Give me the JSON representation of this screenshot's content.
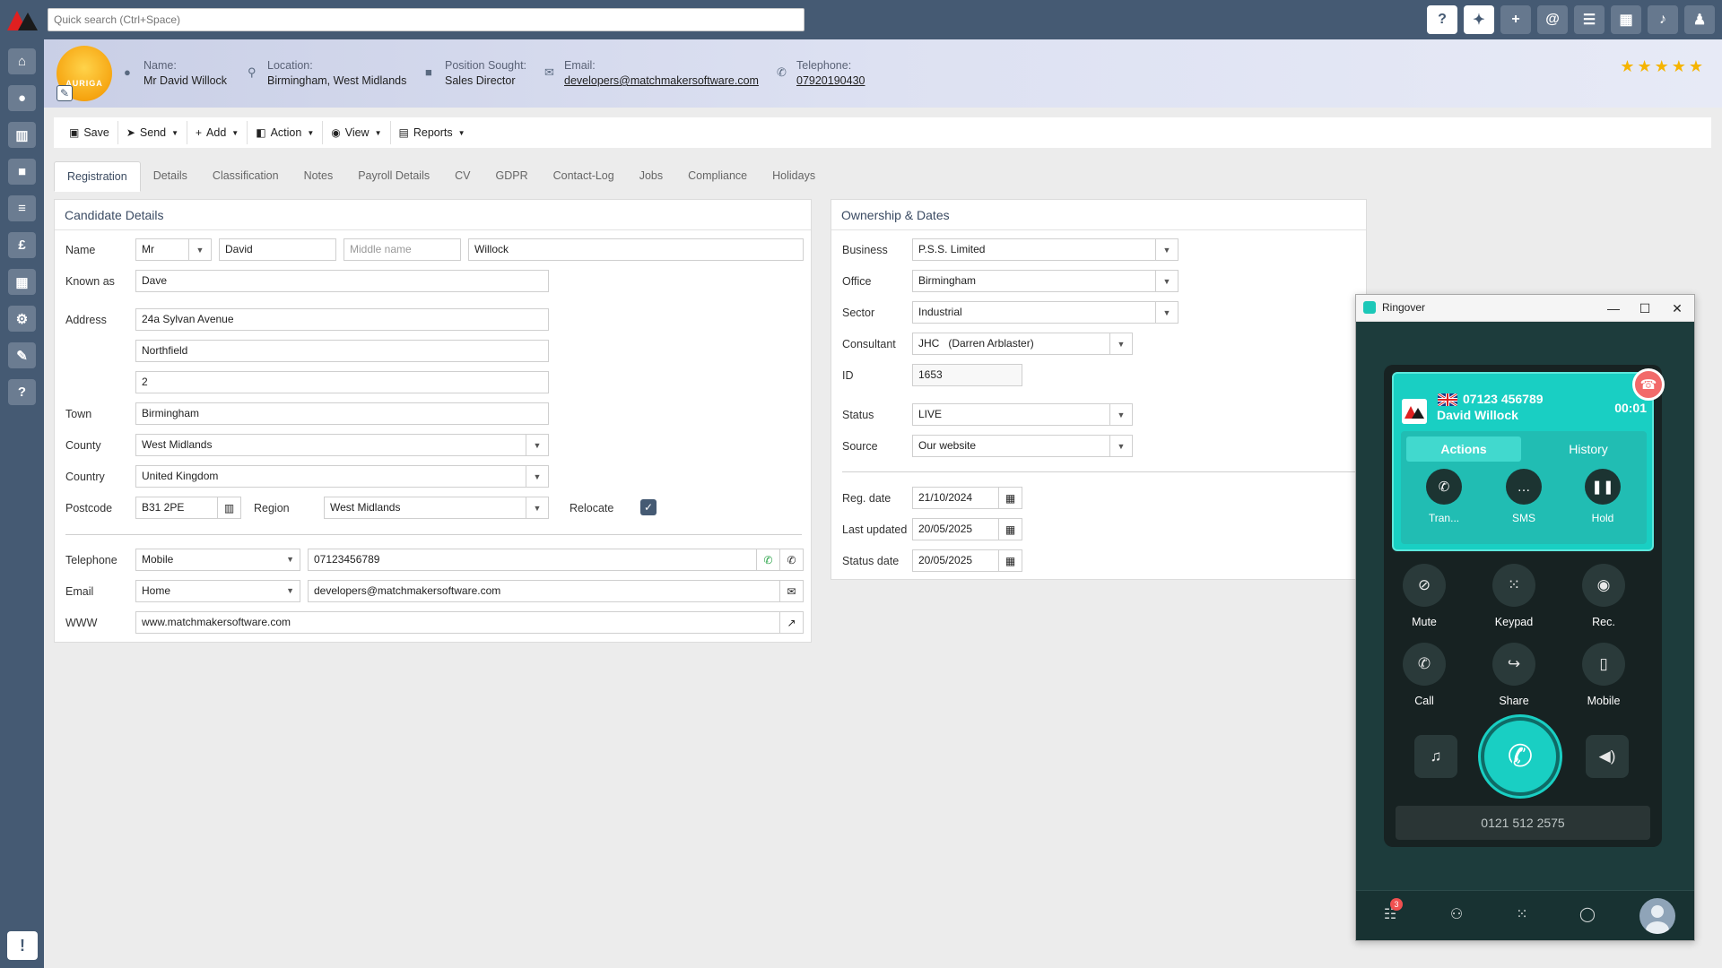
{
  "search": {
    "placeholder": "Quick search (Ctrl+Space)"
  },
  "topbar": {
    "icons": [
      "help-icon",
      "sparkle-icon",
      "plus-icon",
      "at-icon",
      "checklist-icon",
      "calendar-icon",
      "bell-icon",
      "user-settings-icon"
    ]
  },
  "sidebar": {
    "items": [
      "home-icon",
      "person-icon",
      "building-icon",
      "briefcase-icon",
      "list-icon",
      "pound-icon",
      "calendar-icon",
      "gears-icon",
      "wrench-icon",
      "question-icon"
    ],
    "feedback": "!"
  },
  "header": {
    "avatar_text": "AURIGA",
    "name_label": "Name:",
    "name": "Mr David Willock",
    "location_label": "Location:",
    "location": "Birmingham, West Midlands",
    "position_label": "Position Sought:",
    "position": "Sales Director",
    "email_label": "Email:",
    "email": "developers@matchmakersoftware.com",
    "telephone_label": "Telephone:",
    "telephone": "07920190430",
    "rating": "★★★★★"
  },
  "toolbar": {
    "save": "Save",
    "send": "Send",
    "add": "Add",
    "action": "Action",
    "view": "View",
    "reports": "Reports"
  },
  "tabs": [
    "Registration",
    "Details",
    "Classification",
    "Notes",
    "Payroll Details",
    "CV",
    "GDPR",
    "Contact-Log",
    "Jobs",
    "Compliance",
    "Holidays"
  ],
  "candidate": {
    "title": "Candidate Details",
    "name_label": "Name",
    "salutation": "Mr",
    "first_name": "David",
    "middle_placeholder": "Middle name",
    "last_name": "Willock",
    "known_as_label": "Known as",
    "known_as": "Dave",
    "address_label": "Address",
    "address1": "24a Sylvan Avenue",
    "address2": "Northfield",
    "address3": "2",
    "town_label": "Town",
    "town": "Birmingham",
    "county_label": "County",
    "county": "West Midlands",
    "country_label": "Country",
    "country": "United Kingdom",
    "postcode_label": "Postcode",
    "postcode": "B31 2PE",
    "region_label": "Region",
    "region": "West Midlands",
    "relocate_label": "Relocate",
    "relocate_checked": true,
    "telephone_label": "Telephone",
    "telephone_type": "Mobile",
    "telephone": "07123456789",
    "email_label": "Email",
    "email_type": "Home",
    "email": "developers@matchmakersoftware.com",
    "www_label": "WWW",
    "www": "www.matchmakersoftware.com"
  },
  "ownership": {
    "title": "Ownership & Dates",
    "business_label": "Business",
    "business": "P.S.S. Limited",
    "office_label": "Office",
    "office": "Birmingham",
    "sector_label": "Sector",
    "sector": "Industrial",
    "consultant_label": "Consultant",
    "consultant": "JHC   (Darren Arblaster)",
    "id_label": "ID",
    "id": "1653",
    "status_label": "Status",
    "status": "LIVE",
    "source_label": "Source",
    "source": "Our website",
    "reg_date_label": "Reg. date",
    "reg_date": "21/10/2024",
    "last_updated_label": "Last updated",
    "last_updated": "20/05/2025",
    "status_date_label": "Status date",
    "status_date": "20/05/2025"
  },
  "ringover": {
    "window_title": "Ringover",
    "caller_number": "07123 456789",
    "caller_name": "David Willock",
    "timer": "00:01",
    "tab_actions": "Actions",
    "tab_history": "History",
    "card_actions": [
      "Tran...",
      "SMS",
      "Hold"
    ],
    "buttons": [
      "Mute",
      "Keypad",
      "Rec.",
      "Call",
      "Share",
      "Mobile"
    ],
    "dial_number": "0121 512 2575",
    "badge_count": "3",
    "colors": {
      "accent": "#19cfc3",
      "hangup": "#f26a6a",
      "background": "#1d3c3c"
    }
  }
}
